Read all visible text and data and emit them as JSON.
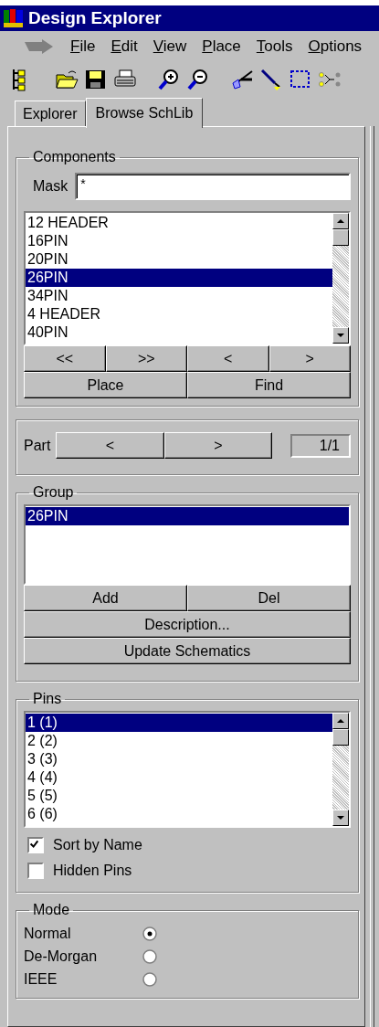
{
  "window": {
    "title": "Design Explorer"
  },
  "menu": [
    "File",
    "Edit",
    "View",
    "Place",
    "Tools",
    "Options"
  ],
  "tabs": [
    {
      "label": "Explorer",
      "selected": false
    },
    {
      "label": "Browse SchLib",
      "selected": true
    }
  ],
  "components": {
    "title": "Components",
    "mask_label": "Mask",
    "mask_value": "*",
    "items": [
      {
        "label": "12 HEADER",
        "selected": false
      },
      {
        "label": "16PIN",
        "selected": false
      },
      {
        "label": "20PIN",
        "selected": false
      },
      {
        "label": "26PIN",
        "selected": true
      },
      {
        "label": "34PIN",
        "selected": false
      },
      {
        "label": "4 HEADER",
        "selected": false
      },
      {
        "label": "40PIN",
        "selected": false
      }
    ],
    "nav_buttons": [
      "<<",
      ">>",
      "<",
      ">"
    ],
    "buttons": [
      "Place",
      "Find"
    ]
  },
  "part": {
    "label": "Part",
    "buttons": [
      "<",
      ">"
    ],
    "counter": "1/1"
  },
  "group": {
    "title": "Group",
    "items": [
      {
        "label": "26PIN",
        "selected": true
      }
    ],
    "buttons": [
      "Add",
      "Del"
    ],
    "wide_buttons": [
      "Description...",
      "Update Schematics"
    ]
  },
  "pins": {
    "title": "Pins",
    "items": [
      {
        "label": "1 (1)",
        "selected": true
      },
      {
        "label": "2 (2)",
        "selected": false
      },
      {
        "label": "3 (3)",
        "selected": false
      },
      {
        "label": "4 (4)",
        "selected": false
      },
      {
        "label": "5 (5)",
        "selected": false
      },
      {
        "label": "6 (6)",
        "selected": false
      }
    ],
    "options": [
      {
        "label": "Sort by Name",
        "checked": true
      },
      {
        "label": "Hidden Pins",
        "checked": false
      }
    ]
  },
  "mode": {
    "title": "Mode",
    "options": [
      {
        "label": "Normal",
        "selected": true
      },
      {
        "label": "De-Morgan",
        "selected": false
      },
      {
        "label": "IEEE",
        "selected": false
      }
    ]
  }
}
